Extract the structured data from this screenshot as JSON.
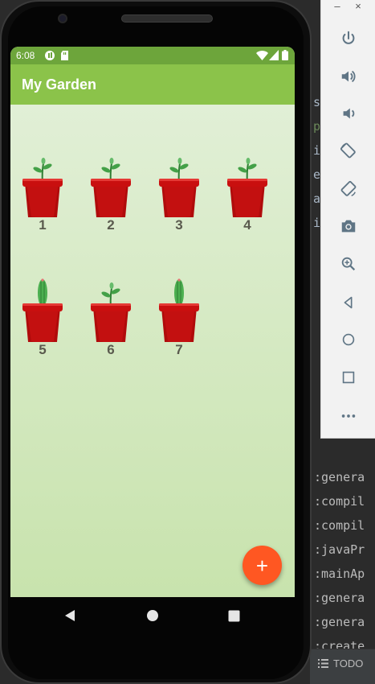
{
  "app": {
    "title": "My Garden"
  },
  "status_bar": {
    "time": "6:08"
  },
  "plants": [
    {
      "label": "1",
      "type": "sprout"
    },
    {
      "label": "2",
      "type": "sprout"
    },
    {
      "label": "3",
      "type": "sprout"
    },
    {
      "label": "4",
      "type": "sprout"
    },
    {
      "label": "5",
      "type": "cactus"
    },
    {
      "label": "6",
      "type": "sprout"
    },
    {
      "label": "7",
      "type": "cactus"
    }
  ],
  "fab": {
    "icon": "plus-icon",
    "label": "+"
  },
  "navigation": [
    "back-icon",
    "home-icon",
    "recents-icon"
  ],
  "emulator_toolbar": {
    "window_controls": [
      "–",
      "×"
    ],
    "buttons": [
      "power-icon",
      "volume-up-icon",
      "volume-down-icon",
      "rotate-left-icon",
      "rotate-right-icon",
      "camera-icon",
      "zoom-icon",
      "back-icon",
      "home-icon",
      "overview-icon",
      "more-icon"
    ]
  },
  "ide": {
    "code_chars": [
      "s",
      "p",
      "i",
      "e",
      "a",
      "i"
    ],
    "log_lines": [
      ":genera",
      ":compil",
      ":compil",
      ":javaPr",
      ":mainAp",
      ":genera",
      ":genera",
      ":create"
    ],
    "bottom_tab": "TODO"
  },
  "colors": {
    "app_bar": "#8bc34a",
    "status_bar": "#6da53b",
    "fab": "#ff5722",
    "background_top": "#e1efd6",
    "background_bottom": "#c8e3ad"
  }
}
